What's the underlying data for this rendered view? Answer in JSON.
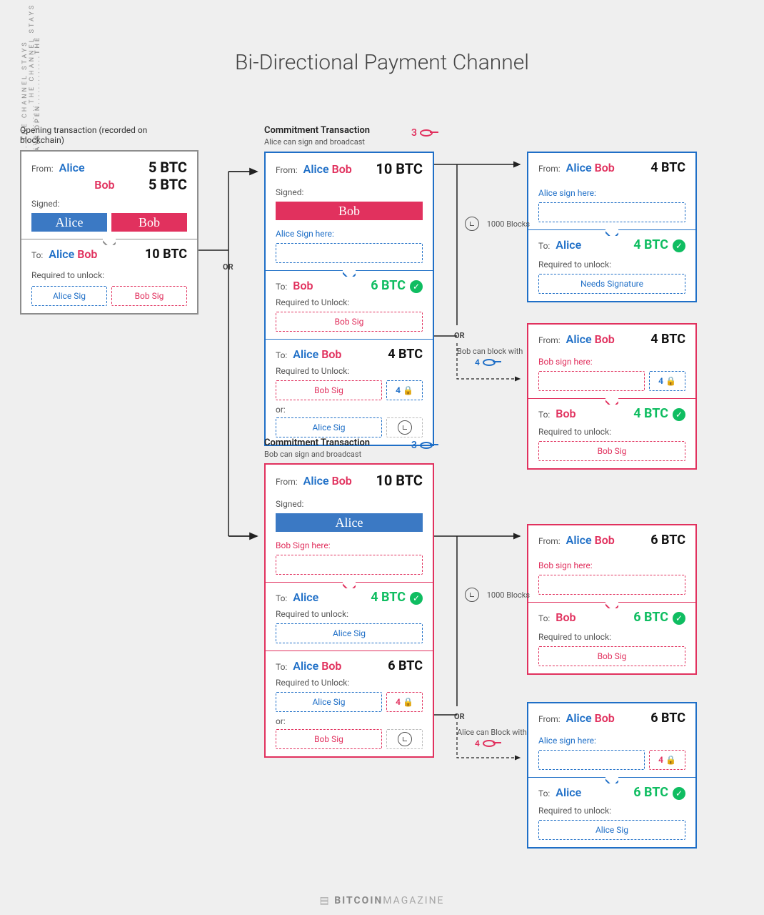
{
  "title": "Bi-Directional Payment Channel",
  "side_text": "..........THE CHANNEL STAYS OPEN.............THE CHANNEL STAYS OPEN",
  "labels": {
    "from": "From:",
    "to": "To:",
    "signed": "Signed:",
    "required": "Required to unlock:",
    "required_U": "Required to Unlock:",
    "or": "or:",
    "OR": "OR",
    "commit": "Commitment Transaction",
    "alice_broadcast": "Alice can sign and broadcast",
    "bob_broadcast": "Bob can sign and broadcast",
    "blocks": "1000 Blocks",
    "bob_block": "Bob can block with",
    "alice_block": "Alice can Block with",
    "open_tx": "Opening transaction (recorded on blockchain)",
    "needs_sig": "Needs Signature"
  },
  "names": {
    "alice": "Alice",
    "bob": "Bob",
    "alice_sig": "Alice Sig",
    "bob_sig": "Bob Sig",
    "alice_sign_here": "Alice Sign here:",
    "bob_sign_here": "Bob Sign here:",
    "alice_sign_here2": "Alice sign here:",
    "bob_sign_here2": "Bob sign here:"
  },
  "key_badges": {
    "red3": "3",
    "blue3": "3",
    "blue4": "4",
    "red4": "4"
  },
  "lock4": "4",
  "open": {
    "alice_amt": "5 BTC",
    "bob_amt": "5 BTC",
    "total": "10 BTC"
  },
  "alice_commit": {
    "total": "10 BTC",
    "bob_out": "6 BTC",
    "shared_out": "4 BTC"
  },
  "bob_commit": {
    "total": "10 BTC",
    "alice_out": "4 BTC",
    "shared_out": "6 BTC"
  },
  "right": {
    "aliceA": "4 BTC",
    "aliceB": "4 BTC",
    "bobA": "4 BTC",
    "bobB": "4 BTC",
    "bobC": "6 BTC",
    "bobD": "6 BTC",
    "aliceC": "6 BTC",
    "aliceD": "6 BTC"
  },
  "brand": {
    "b": "BITCOIN",
    "m": "MAGAZINE"
  }
}
